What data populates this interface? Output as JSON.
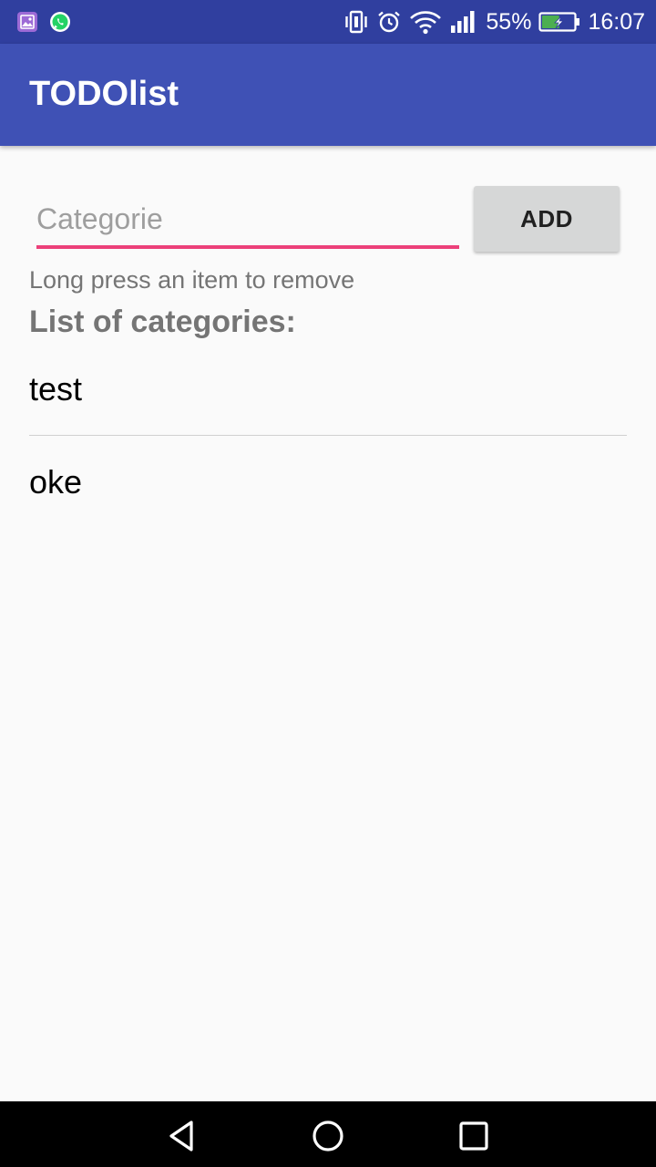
{
  "status_bar": {
    "notification_icons": [
      "gallery-icon",
      "whatsapp-icon"
    ],
    "icons": [
      "vibrate-icon",
      "alarm-icon",
      "wifi-icon",
      "signal-icon"
    ],
    "battery_percent": "55%",
    "battery_level": 0.55,
    "battery_charging": true,
    "time": "16:07"
  },
  "app_bar": {
    "title": "TODOlist"
  },
  "form": {
    "input_placeholder": "Categorie",
    "input_value": "",
    "add_label": "ADD"
  },
  "hint": "Long press an item to remove",
  "list_heading": "List of categories:",
  "categories": [
    {
      "label": "test"
    },
    {
      "label": "oke"
    }
  ],
  "nav_bar": {
    "buttons": [
      "back-icon",
      "home-icon",
      "recents-icon"
    ]
  },
  "colors": {
    "status_bar": "#303f9f",
    "app_bar": "#3f51b5",
    "accent": "#ec407a",
    "button": "#d6d7d7"
  }
}
